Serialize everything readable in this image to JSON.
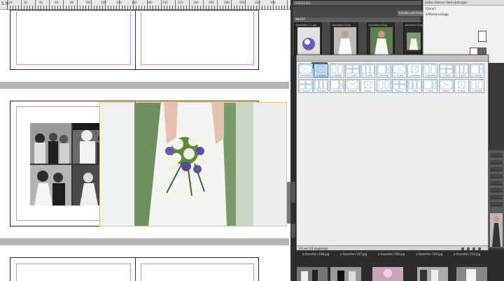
{
  "ruler": {
    "zoom": "S N",
    "numbers": [
      "10",
      "20",
      "40",
      "60",
      "80",
      "100",
      "120",
      "140",
      "160",
      "180",
      "200",
      "220",
      "240",
      "260",
      "280",
      "300",
      "320",
      "340"
    ]
  },
  "photo": {
    "dimension_label": "1.00 x 1.00\n1.00 x 1.00"
  },
  "bridge": {
    "tab_label": "VORSCHAU",
    "panel_label": "Inhalte und Fotos",
    "folder_label": "INHALT",
    "thumbs": [
      {
        "label": "favoriten-2-1.jpg"
      },
      {
        "label": "favoriten-3.jpg"
      },
      {
        "label": "favoriten-4.jpg"
      },
      {
        "label": "favoriten-5.jpg"
      }
    ]
  },
  "pages_panel": {
    "tabs": "Seiten   Ebenen   Verknüpfungen",
    "line1": "[Ohne]",
    "line2": "A-Mustervorlage"
  },
  "dialog": {
    "tabs": [
      "4 photo",
      "portfolio",
      "album"
    ],
    "active_tab": "portfolio",
    "row1": [
      "1 full bleed",
      "1 square",
      "1 vertical",
      "2 - 1 vert...",
      "2 - 2 vert...",
      "2 vertical",
      "3 - 2 vert...",
      "3 vertical",
      "3 vertical",
      "4 - 1 horiz...",
      "4 - 2 horiz...",
      "4 - 3 horiz..."
    ],
    "row2": [
      "4 - 3 vertic...",
      "4 square",
      "4 vertical",
      "5 vertical",
      "5 story",
      "6 horizontal",
      "6 story",
      "7 story",
      "7 story",
      "8 story",
      "9 story",
      "9 vertical"
    ],
    "selected": "1 square",
    "count": "24 von 24 angezeigt"
  },
  "filmstrip": {
    "names": [
      "x-favoriten-106.jpg",
      "x-favoriten-107.jpg",
      "x-favoriten-108.jpg",
      "x-favoriten-109.jpg",
      "x-favoriten-110.jpg"
    ]
  },
  "colors": {
    "margin_guide": "#d08ad8",
    "bleed_guide": "#e5c07a",
    "selection": "#3a6ec9",
    "panel_dark": "#3a3a3a"
  }
}
